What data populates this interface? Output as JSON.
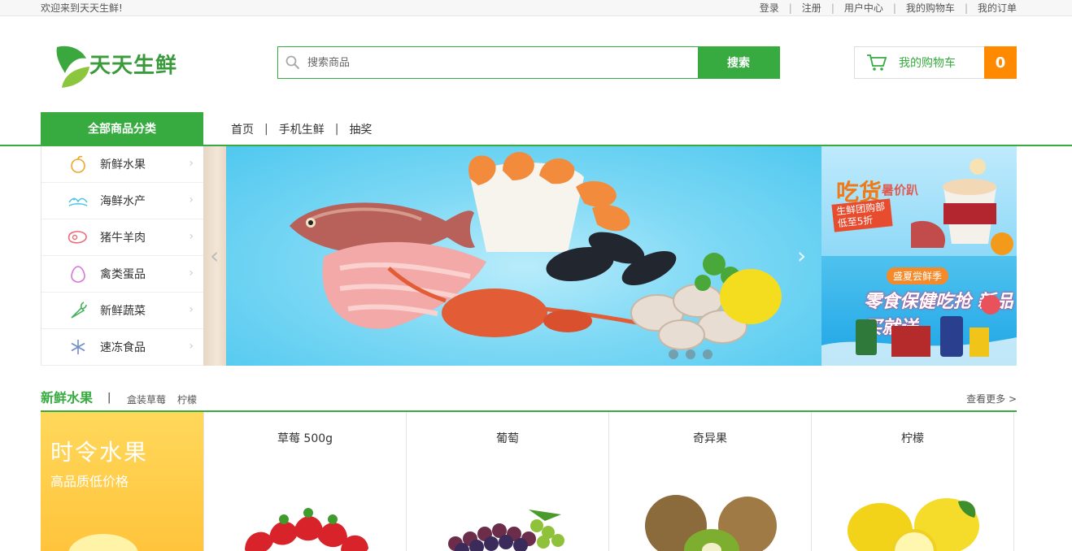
{
  "topbar": {
    "welcome": "欢迎来到天天生鲜!",
    "links": [
      "登录",
      "注册",
      "用户中心",
      "我的购物车",
      "我的订单"
    ]
  },
  "header": {
    "logo_text": "天天生鲜",
    "search_placeholder": "搜索商品",
    "search_button": "搜索",
    "cart_label": "我的购物车",
    "cart_count": "0"
  },
  "nav": {
    "all_categories": "全部商品分类",
    "menu": [
      "首页",
      "手机生鲜",
      "抽奖"
    ]
  },
  "categories": [
    {
      "label": "新鲜水果",
      "icon": "fruit-icon"
    },
    {
      "label": "海鲜水产",
      "icon": "seafood-icon"
    },
    {
      "label": "猪牛羊肉",
      "icon": "meat-icon"
    },
    {
      "label": "禽类蛋品",
      "icon": "egg-icon"
    },
    {
      "label": "新鲜蔬菜",
      "icon": "vegetable-icon"
    },
    {
      "label": "速冻食品",
      "icon": "frozen-icon"
    }
  ],
  "banner": {
    "slide_count": 3
  },
  "ads": {
    "ad1": {
      "title": "吃货",
      "subtitle": "暑价趴",
      "tag": "生鲜团购部 低至5折"
    },
    "ad2": {
      "tag": "盛夏尝鲜季",
      "title": "零食保健吃抢 新品买就送"
    }
  },
  "section": {
    "title": "新鲜水果",
    "sublinks": [
      "盒装草莓",
      "柠檬"
    ],
    "more": "查看更多 >",
    "promo_title": "时令水果",
    "promo_subtitle": "高品质低价格",
    "products": [
      {
        "name": "草莓 500g"
      },
      {
        "name": "葡萄"
      },
      {
        "name": "奇异果"
      },
      {
        "name": "柠檬"
      }
    ]
  },
  "colors": {
    "brand_green": "#37ab40",
    "cart_orange": "#ff8a00"
  }
}
